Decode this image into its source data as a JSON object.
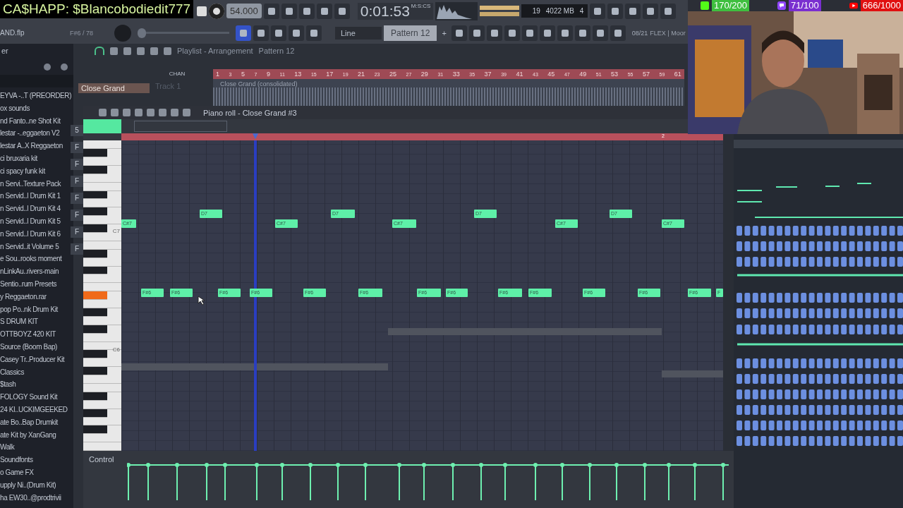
{
  "overlay": {
    "donation": "CA$HAPP: $Blancobodiedit777"
  },
  "transport": {
    "tempo": "54.000",
    "time": "0:01:53",
    "time_unit": "M:S:CS",
    "cpu": "19",
    "memory": "4022 MB",
    "polyphony": "4"
  },
  "project": {
    "file": "AND.flp",
    "hint": "F#6 / 78",
    "pitch": {
      "level": 0
    },
    "snap": "Line",
    "pattern": "Pattern 12",
    "add": "+",
    "news": "08/21",
    "news_title": "FLEX | Moor"
  },
  "browser": {
    "title": "er",
    "items": [
      "EYVA -..T (PREORDER)",
      "ox sounds",
      "nd Fanto..ne Shot Kit",
      "lestar -..eggaeton V2",
      "lestar A..X Reggaeton",
      "ci bruxaria kit",
      "ci spacy funk kit",
      "n Servi..Texture Pack",
      "n Servid..l Drum Kit 1",
      "n Servid..l Drum Kit 4",
      "n Servid..l Drum Kit 5",
      "n Servid..l Drum Kit 6",
      "n Servid..it Volume 5",
      "e Sou..rooks moment",
      "nLinkAu..rivers-main",
      "Sentio..rum Presets",
      "y Reggaeton.rar",
      "pop Po..nk Drum Kit",
      "S DRUM KIT",
      "OTTBOYZ 420 KIT",
      "Source (Boom Bap)",
      "Casey Tr..Producer Kit",
      "Classics",
      "$tash",
      "FOLOGY Sound Kit",
      "24 KI..UCKIMGEEKED",
      "ate Bo..Bap Drumkit",
      "ate Kit by XanGang",
      "Walk",
      "Soundfonts",
      "o Game FX",
      "upply Ni..(Drum Kit)",
      "ha EW30..@prodtrivii"
    ]
  },
  "playlist": {
    "title": "Playlist - Arrangement",
    "pattern": "Pattern 12",
    "column_label": "CHAN",
    "channel": "Close Grand",
    "channel_tabs": [
      "5",
      "F",
      "F",
      "F",
      "F",
      "F",
      "F",
      "F"
    ],
    "track": "Track 1",
    "clip": "Close Grand (consolidated)",
    "ruler": [
      "1",
      "3",
      "5",
      "7",
      "9",
      "11",
      "13",
      "15",
      "17",
      "19",
      "21",
      "23",
      "25",
      "27",
      "29",
      "31",
      "33",
      "35",
      "37",
      "39",
      "41",
      "43",
      "45",
      "47",
      "49",
      "51",
      "53",
      "55",
      "57",
      "59",
      "61"
    ]
  },
  "piano_roll": {
    "title": "Piano roll - Close Grand #3",
    "ruler": [
      "2"
    ],
    "octaves": [
      "C7",
      "C6"
    ],
    "control": "Control",
    "notes": [
      {
        "label": "C#7"
      },
      {
        "label": "D7"
      },
      {
        "label": "C#7"
      },
      {
        "label": "D7"
      },
      {
        "label": "C#7"
      },
      {
        "label": "D7"
      },
      {
        "label": "C#7"
      },
      {
        "label": "D7"
      },
      {
        "label": "C#7"
      },
      {
        "label": "F#6"
      },
      {
        "label": "F#6"
      },
      {
        "label": "F#6"
      },
      {
        "label": "F#6"
      },
      {
        "label": "F#6"
      },
      {
        "label": "F#6"
      },
      {
        "label": "F#6"
      },
      {
        "label": "F#6"
      },
      {
        "label": "F#6"
      },
      {
        "label": "F#6"
      },
      {
        "label": "F#6"
      },
      {
        "label": "F#6"
      },
      {
        "label": "F#6"
      },
      {
        "label": "F"
      }
    ]
  },
  "stream": {
    "badges": [
      {
        "kind": "kick",
        "text": "170/200",
        "color": "#3fbf3f"
      },
      {
        "kind": "chat",
        "text": "71/100",
        "color": "#7a2fd0"
      },
      {
        "kind": "youtube",
        "text": "666/1000",
        "color": "#e01010"
      }
    ]
  }
}
